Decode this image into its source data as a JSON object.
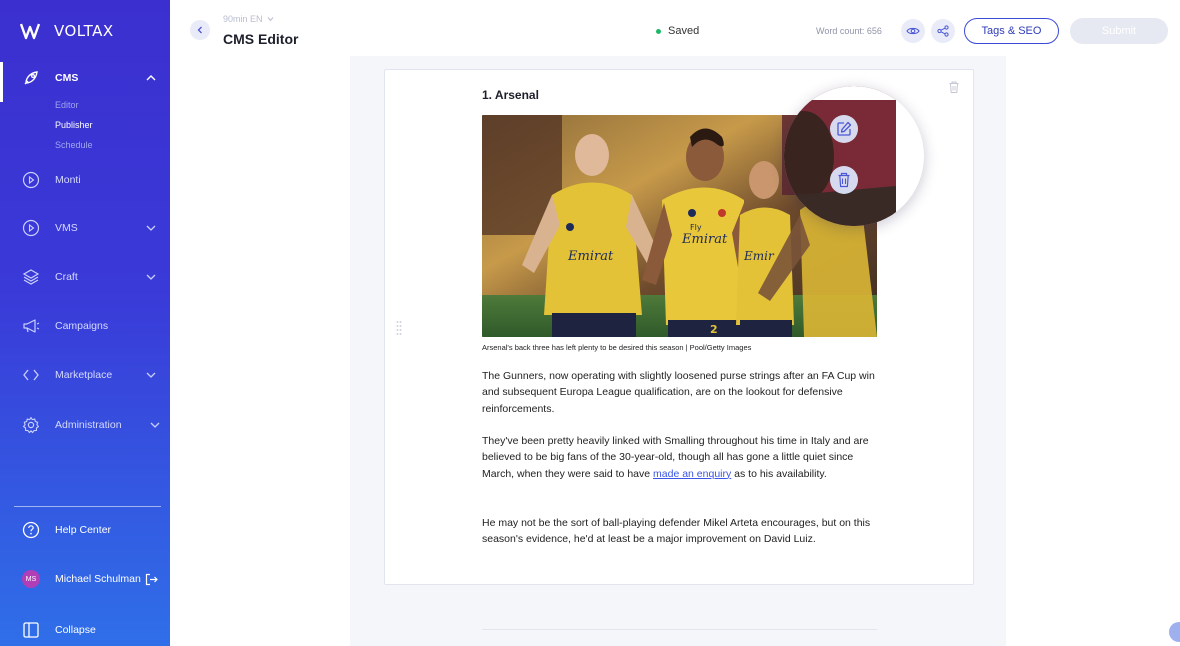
{
  "brand": {
    "name": "VOLTAX"
  },
  "sidebar": {
    "cms": {
      "label": "CMS",
      "sub": [
        "Editor",
        "Publisher",
        "Schedule"
      ]
    },
    "items": [
      {
        "label": "Monti"
      },
      {
        "label": "VMS"
      },
      {
        "label": "Craft"
      },
      {
        "label": "Campaigns"
      },
      {
        "label": "Marketplace"
      },
      {
        "label": "Administration"
      }
    ],
    "help": "Help Center",
    "user": {
      "initials": "MS",
      "name": "Michael Schulman"
    },
    "collapse": "Collapse"
  },
  "header": {
    "site": "90min EN",
    "title": "CMS Editor",
    "status": "Saved",
    "word_count": "Word count: 656",
    "tags_button": "Tags & SEO",
    "submit_button": "Submit"
  },
  "article": {
    "heading": "1.  Arsenal",
    "caption": "Arsenal's back three has left plenty to be desired this season | Pool/Getty Images",
    "p1": "The Gunners, now operating with slightly loosened purse strings after an FA Cup win and subsequent Europa League qualification, are on the lookout for defensive reinforcements.",
    "p2_before": "They've been pretty heavily linked with Smalling throughout his time in Italy and are believed to be big fans of the 30-year-old, though all has gone a little quiet since March, when they were said to have ",
    "p2_link": "made an enquiry",
    "p2_after": " as to his availability.",
    "p3": "He may not be the sort of ball-playing defender Mikel Arteta encourages, but on this season's evidence, he'd at least be a major improvement on David Luiz."
  },
  "image": {
    "shirt_text": "Fly Emirates",
    "shirt_numbers": [
      "2"
    ]
  },
  "colors": {
    "sidebar_top": "#3b2fcf",
    "sidebar_bottom": "#2f6fe8",
    "accent": "#3b4bd8",
    "saved_dot": "#1fb868",
    "link": "#3b55e6"
  }
}
